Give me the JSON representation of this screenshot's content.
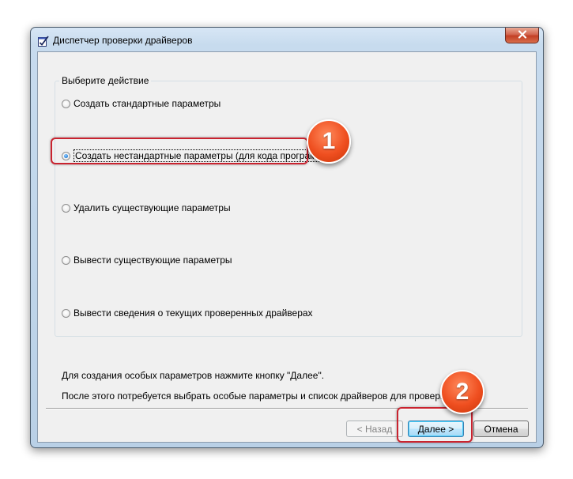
{
  "window": {
    "title": "Диспетчер проверки драйверов"
  },
  "group": {
    "legend": "Выберите действие",
    "options": [
      {
        "label": "Создать стандартные параметры",
        "checked": false
      },
      {
        "label": "Создать нестандартные параметры (для кода программ)",
        "checked": true
      },
      {
        "label": "Удалить существующие параметры",
        "checked": false
      },
      {
        "label": "Вывести существующие параметры",
        "checked": false
      },
      {
        "label": "Вывести сведения о текущих проверенных драйверах",
        "checked": false
      }
    ]
  },
  "info": {
    "line1": "Для создания особых параметров нажмите кнопку \"Далее\".",
    "line2": "После этого потребуется выбрать особые параметры и список драйверов для проверки."
  },
  "buttons": {
    "back": "< Назад",
    "next": "Далее >",
    "cancel": "Отмена"
  },
  "callouts": {
    "step1": "1",
    "step2": "2"
  },
  "colors": {
    "callout_ring": "#c9232f",
    "callout_badge": "#ef4f20",
    "client_bg": "#f0f0f0"
  },
  "icons": {
    "app": "checklist-icon",
    "close": "close-icon"
  }
}
